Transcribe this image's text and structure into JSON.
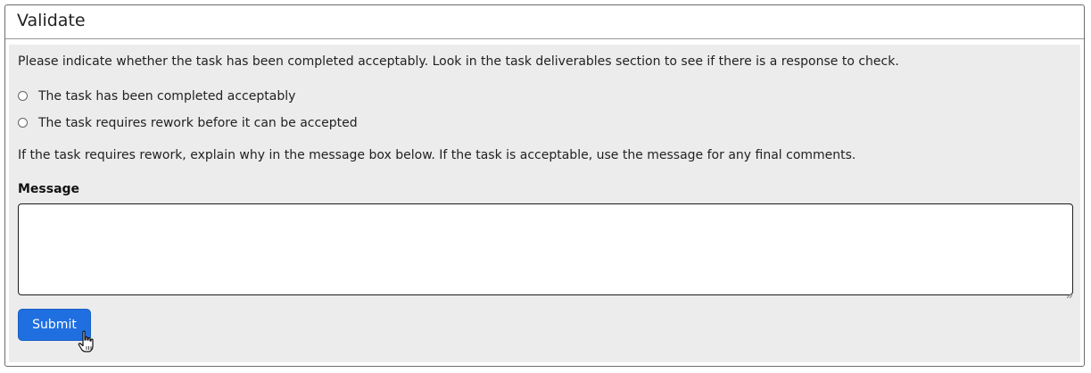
{
  "header": {
    "title": "Validate"
  },
  "body": {
    "intro": "Please indicate whether the task has been completed acceptably. Look in the task deliverables section to see if there is a response to check.",
    "options": [
      {
        "label": "The task has been completed acceptably",
        "selected": false
      },
      {
        "label": "The task requires rework before it can be accepted",
        "selected": false
      }
    ],
    "explain": "If the task requires rework, explain why in the message box below. If the task is acceptable, use the message for any final comments.",
    "message": {
      "label": "Message",
      "value": ""
    },
    "submit_label": "Submit"
  },
  "colors": {
    "accent": "#1f6fe0",
    "panel": "#ececec"
  },
  "icons": {
    "cursor": "hand-pointer-icon"
  }
}
